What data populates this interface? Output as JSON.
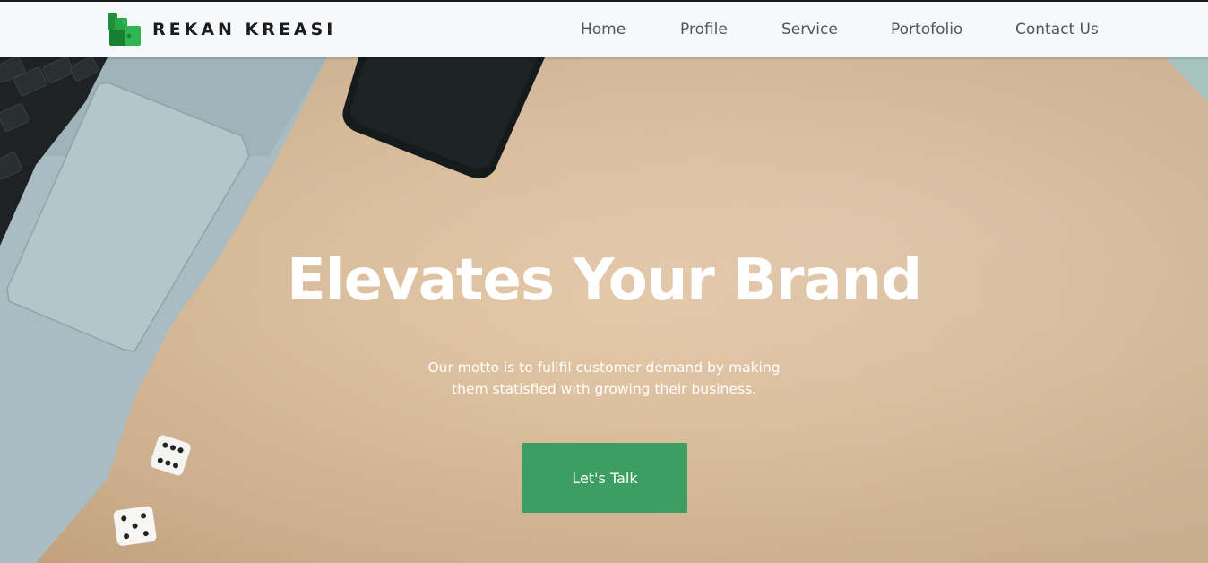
{
  "brand": {
    "name": "REKAN KREASI",
    "logo_icon": "puzzle-logo-icon",
    "logo_color": "#1f9a3a"
  },
  "nav": {
    "items": [
      {
        "label": "Home"
      },
      {
        "label": "Profile"
      },
      {
        "label": "Service"
      },
      {
        "label": "Portofolio"
      },
      {
        "label": "Contact Us"
      }
    ]
  },
  "hero": {
    "title": "Elevates Your Brand",
    "subtitle": "Our motto is to fullfil customer demand by making them statisfied with growing their business.",
    "cta_label": "Let's Talk",
    "cta_color": "#3d9e63"
  }
}
